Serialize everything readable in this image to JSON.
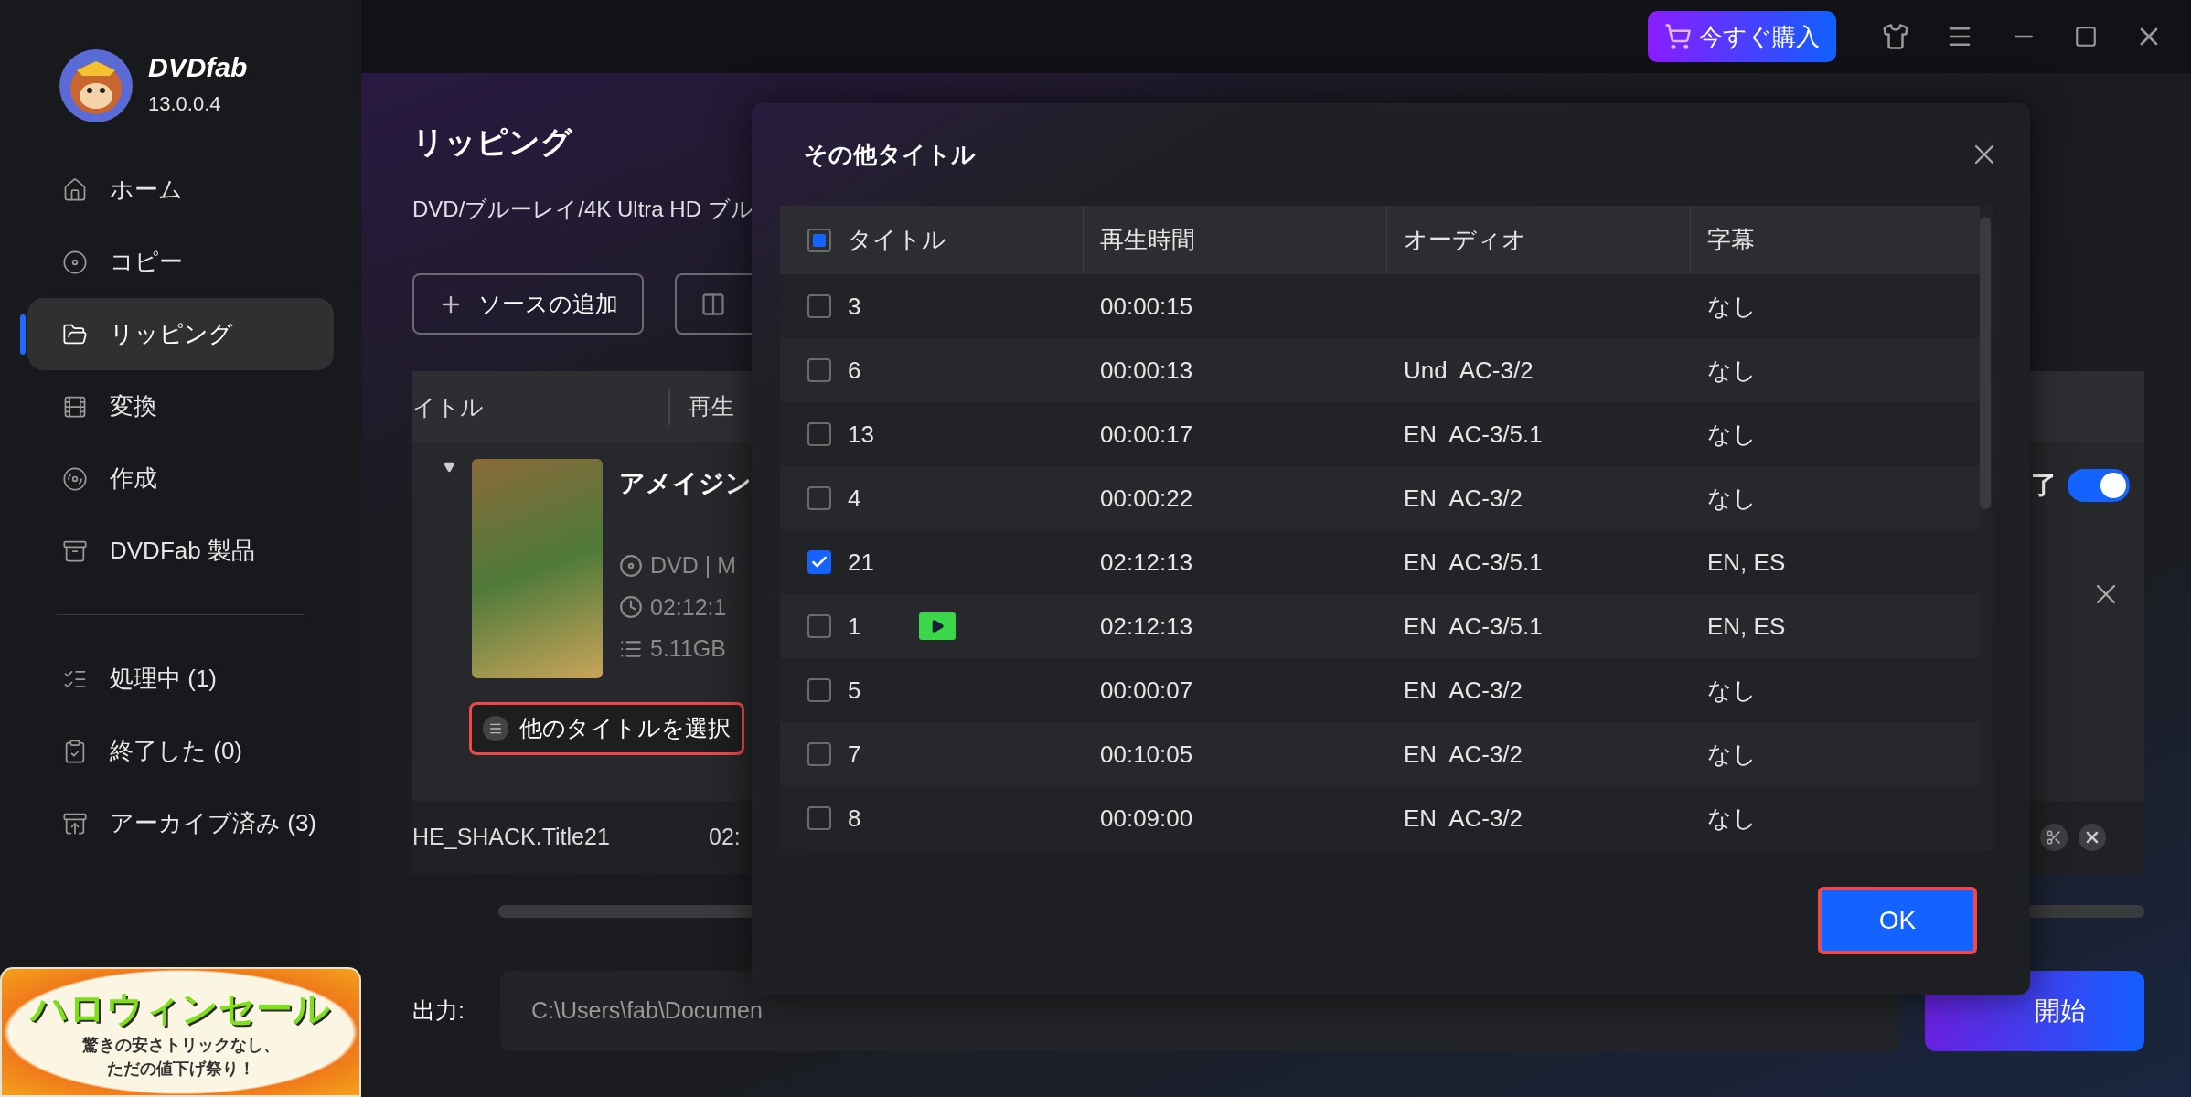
{
  "app": {
    "name": "DVDfab",
    "version": "13.0.0.4"
  },
  "sidebar": {
    "items": [
      {
        "label": "ホーム",
        "selected": false
      },
      {
        "label": "コピー",
        "selected": false
      },
      {
        "label": "リッピング",
        "selected": true
      },
      {
        "label": "変換",
        "selected": false
      },
      {
        "label": "作成",
        "selected": false
      },
      {
        "label": "DVDFab 製品",
        "selected": false
      }
    ],
    "queue_items": [
      {
        "label": "処理中 (1)",
        "selected": false
      },
      {
        "label": "終了した (0)",
        "selected": false
      },
      {
        "label": "アーカイブ済み (3)",
        "selected": false
      }
    ]
  },
  "banner": {
    "title": "ハロウィンセール",
    "lines": [
      "驚きの安さトリックなし、",
      "ただの値下げ祭り！"
    ]
  },
  "top_bar": {
    "buy_button": "今すぐ購入"
  },
  "page": {
    "title": "リッピング",
    "subtitle": "DVD/ブルーレイ/4K Ultra HD ブル",
    "add_source_button": "ソースの追加",
    "table": {
      "column_1": "イトル",
      "column_2": "再生",
      "source": {
        "title": "アメイジン",
        "expanded": true,
        "info": [
          {
            "kind": "disc",
            "text": "DVD | M"
          },
          {
            "kind": "clock",
            "text": "02:12:1"
          },
          {
            "kind": "size",
            "text": "5.11GB"
          }
        ],
        "select_titles_button": "他のタイトルを選択",
        "option_label": "了",
        "option_on": true
      },
      "title_row": {
        "name": "HE_SHACK.Title21",
        "duration": "02:"
      }
    }
  },
  "output": {
    "label": "出力:",
    "path": "C:\\Users\\fab\\Documen"
  },
  "start_button": "開始",
  "dialog": {
    "title": "その他タイトル",
    "columns": [
      "タイトル",
      "再生時間",
      "オーディオ",
      "字幕"
    ],
    "select_all": {
      "indeterminate": true
    },
    "rows": [
      {
        "title": "3",
        "duration": "00:00:15",
        "subtitle": "なし",
        "checked": false,
        "preview": false
      },
      {
        "title": "6",
        "duration": "00:00:13",
        "audio": "Und  AC-3/2",
        "subtitle": "なし",
        "checked": false,
        "preview": false
      },
      {
        "title": "13",
        "duration": "00:00:17",
        "audio": "EN  AC-3/5.1",
        "subtitle": "なし",
        "checked": false,
        "preview": false
      },
      {
        "title": "4",
        "duration": "00:00:22",
        "audio": "EN  AC-3/2",
        "subtitle": "なし",
        "checked": false,
        "preview": false
      },
      {
        "title": "21",
        "duration": "02:12:13",
        "audio": "EN  AC-3/5.1",
        "subtitle": "EN, ES",
        "checked": true,
        "preview": false
      },
      {
        "title": "1",
        "duration": "02:12:13",
        "audio": "EN  AC-3/5.1",
        "subtitle": "EN, ES",
        "checked": false,
        "preview": true
      },
      {
        "title": "5",
        "duration": "00:00:07",
        "audio": "EN  AC-3/2",
        "subtitle": "なし",
        "checked": false,
        "preview": false
      },
      {
        "title": "7",
        "duration": "00:10:05",
        "audio": "EN  AC-3/2",
        "subtitle": "なし",
        "checked": false,
        "preview": false
      },
      {
        "title": "8",
        "duration": "00:09:00",
        "audio": "EN  AC-3/2",
        "subtitle": "なし",
        "checked": false,
        "preview": false
      }
    ],
    "ok_button": "OK"
  }
}
